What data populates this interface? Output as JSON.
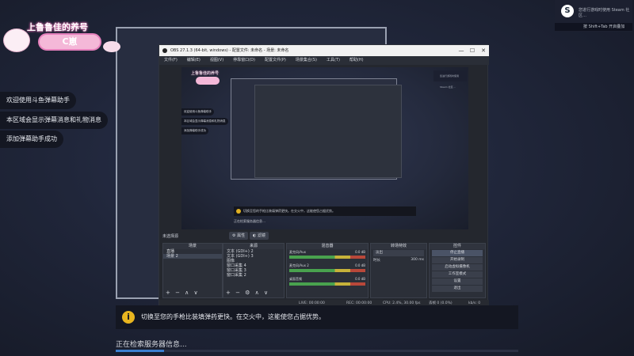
{
  "logo": {
    "title": "上鲁鲁佳的养号",
    "badge": "C崽"
  },
  "chat": {
    "messages": [
      "欢迎使用斗鱼弹幕助手",
      "本区域会显示弹幕消息和礼物消息",
      "添加弹幕助手成功"
    ]
  },
  "steam": {
    "message": "您进行游戏时使用 Steam 社区…",
    "bar_label": "按 Shift+Tab 开启叠加"
  },
  "obs": {
    "title": "OBS 27.1.3 (64-bit, windows) - 配置文件: 未命名 - 场景: 未命名",
    "menu": [
      "文件(F)",
      "编辑(E)",
      "视图(V)",
      "停靠窗口(D)",
      "配置文件(P)",
      "场景集合(S)",
      "工具(T)",
      "帮助(H)"
    ],
    "controls_window": [
      "—",
      "☐",
      "✕"
    ],
    "scene_status": "未选择源",
    "props_label": "属性",
    "filters_label": "滤镜",
    "docks": {
      "scenes": {
        "title": "场景",
        "items": [
          "直播",
          "场景 2"
        ]
      },
      "sources": {
        "title": "来源",
        "items": [
          "文本 (GDI+) 2",
          "文本 (GDI+) 3",
          "图像",
          "窗口采集 4",
          "窗口采集 3",
          "窗口采集 2"
        ]
      },
      "mixer": {
        "title": "混音器",
        "channels": [
          {
            "name": "麦克风/Aux",
            "level": "0.0 dB"
          },
          {
            "name": "麦克风/Aux 2",
            "level": "0.0 dB"
          },
          {
            "name": "桌面音频",
            "level": "0.0 dB"
          }
        ]
      },
      "transitions": {
        "title": "转场特效",
        "type": "淡出",
        "duration_label": "时长",
        "duration": "300 ms"
      },
      "controls": {
        "title": "控件",
        "buttons": [
          "停止直播",
          "开始录制",
          "启动虚拟摄像机",
          "工作室模式",
          "设置",
          "退出"
        ]
      }
    },
    "statusbar": {
      "live": "LIVE: 00:00:00",
      "rec": "REC: 00:00:00",
      "cpu": "CPU: 2.4%, 30.00 fps",
      "frames": "丢帧 0 (0.0%)",
      "kbps": "kb/s: 0"
    },
    "nested": {
      "notice": "切换至您的手枪比装填弹药更快。在交火中，这能使您占据优势。",
      "status": "正在检索服务器信息…"
    }
  },
  "notice": {
    "text": "切换至您的手枪比装填弹药更快。在交火中，这能使您占据优势。"
  },
  "loading": {
    "text": "正在检索服务器信息...",
    "progress": 0.12
  }
}
